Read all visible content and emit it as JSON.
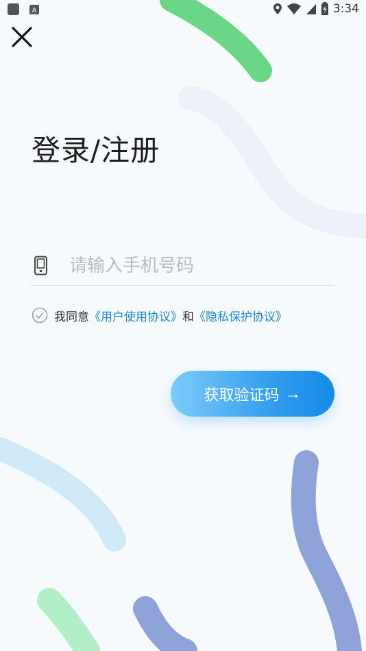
{
  "status_bar": {
    "time": "3:34"
  },
  "page": {
    "title": "登录/注册"
  },
  "phone": {
    "placeholder": "请输入手机号码",
    "value": ""
  },
  "agreement": {
    "prefix": "我同意",
    "user_agreement": "《用户使用协议》",
    "conjunction": "和",
    "privacy_agreement": "《隐私保护协议》"
  },
  "action": {
    "label": "获取验证码",
    "arrow": "→"
  },
  "colors": {
    "accent": "#158ae9",
    "link": "#1689dc",
    "green_stroke": "#6ad787",
    "light_blue_stroke": "#cfe9f8",
    "indigo_stroke": "#8ea4d9"
  },
  "icons": [
    "close-icon",
    "phone-icon",
    "check-circle-icon",
    "arrow-right-icon",
    "location-icon",
    "wifi-icon",
    "signal-icon",
    "battery-icon"
  ]
}
